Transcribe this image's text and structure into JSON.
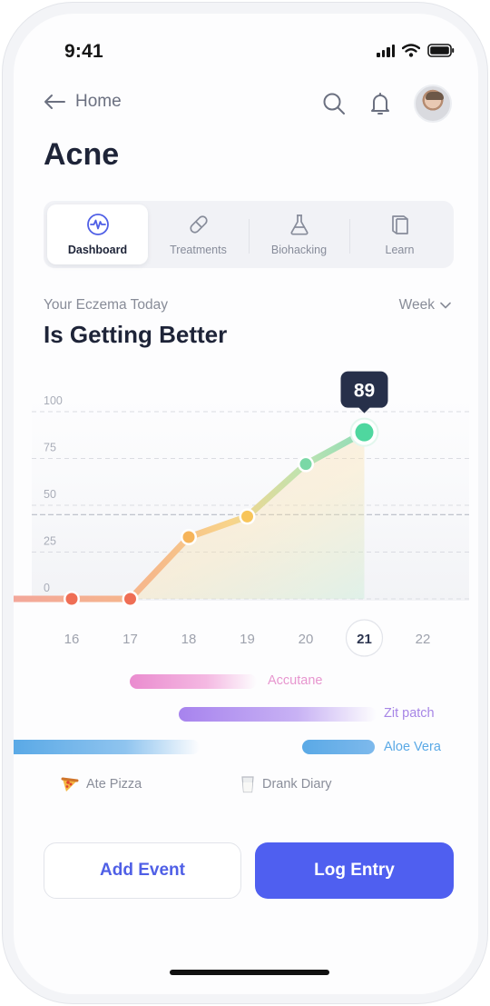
{
  "status_bar": {
    "time": "9:41"
  },
  "header": {
    "back_label": "Home"
  },
  "page_title": "Acne",
  "tabs": [
    {
      "label": "Dashboard",
      "icon": "pulse-icon",
      "active": true
    },
    {
      "label": "Treatments",
      "icon": "pill-icon",
      "active": false
    },
    {
      "label": "Biohacking",
      "icon": "flask-icon",
      "active": false
    },
    {
      "label": "Learn",
      "icon": "book-icon",
      "active": false
    }
  ],
  "trend": {
    "subtitle": "Your Eczema Today",
    "period": "Week",
    "headline": "Is Getting Better"
  },
  "chart_data": {
    "type": "line",
    "x": [
      16,
      17,
      18,
      19,
      20,
      21
    ],
    "x_ticks": [
      "16",
      "17",
      "18",
      "19",
      "20",
      "21",
      "22"
    ],
    "selected_x": "21",
    "values": [
      0,
      0,
      33,
      44,
      72,
      89
    ],
    "point_colors": [
      "#ef6e55",
      "#ef6e55",
      "#f6b45a",
      "#f8c55a",
      "#7ad8a6",
      "#4fd79f"
    ],
    "y_ticks": [
      "100",
      "75",
      "50",
      "25",
      "0"
    ],
    "ylim": [
      0,
      100
    ],
    "highlight_label": "89",
    "grid": "dashed"
  },
  "events": [
    {
      "label": "Accutane",
      "color": "#ea8ccf"
    },
    {
      "label": "Zit patch",
      "color": "#a783ee"
    },
    {
      "label": "Aloe Vera",
      "color": "#5aa9e6"
    }
  ],
  "notes": [
    {
      "label": "Ate Pizza",
      "icon": "pizza-icon"
    },
    {
      "label": "Drank Diary",
      "icon": "glass-icon"
    }
  ],
  "actions": {
    "add_event": "Add Event",
    "log_entry": "Log Entry"
  }
}
